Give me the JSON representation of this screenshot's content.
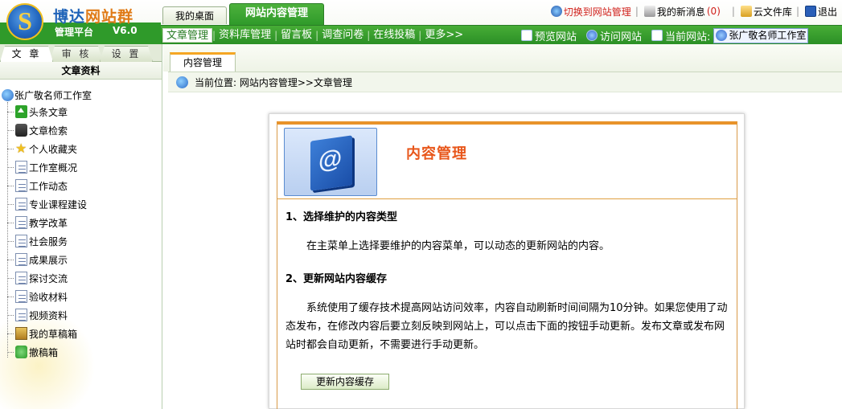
{
  "app": {
    "brand_part1": "博达",
    "brand_part2": "网站群",
    "platform_label": "管理平台",
    "version": "V6.0"
  },
  "top_tabs": [
    {
      "label": "我的桌面",
      "active": false
    },
    {
      "label": "网站内容管理",
      "active": true
    }
  ],
  "top_links": {
    "switch": "切换到网站管理",
    "messages": "我的新消息",
    "message_count": "(0)",
    "cloud": "云文件库",
    "logout": "退出"
  },
  "nav": {
    "items": [
      "文章管理",
      "资料库管理",
      "留言板",
      "调查问卷",
      "在线投稿",
      "更多>>"
    ],
    "active_index": 0,
    "preview": "预览网站",
    "visit": "访问网站",
    "current_label": "当前网站:",
    "current_site": "张广敬名师工作室"
  },
  "sidebar": {
    "tabs": [
      "文 章",
      "审 核",
      "设 置"
    ],
    "header": "文章资料",
    "root": "张广敬名师工作室",
    "items": [
      {
        "label": "头条文章",
        "icon": "up-arrow-icon"
      },
      {
        "label": "文章检索",
        "icon": "search-icon"
      },
      {
        "label": "个人收藏夹",
        "icon": "star-icon"
      },
      {
        "label": "工作室概况",
        "icon": "document-icon"
      },
      {
        "label": "工作动态",
        "icon": "document-icon"
      },
      {
        "label": "专业课程建设",
        "icon": "document-icon"
      },
      {
        "label": "教学改革",
        "icon": "document-icon"
      },
      {
        "label": "社会服务",
        "icon": "document-icon"
      },
      {
        "label": "成果展示",
        "icon": "document-icon"
      },
      {
        "label": "探讨交流",
        "icon": "document-icon"
      },
      {
        "label": "验收材料",
        "icon": "document-icon"
      },
      {
        "label": "视频资料",
        "icon": "document-icon"
      },
      {
        "label": "我的草稿箱",
        "icon": "draft-icon"
      },
      {
        "label": "撤稿箱",
        "icon": "recycle-icon"
      }
    ]
  },
  "main": {
    "tab": "内容管理",
    "breadcrumb": "当前位置: 网站内容管理>>文章管理",
    "panel_title": "内容管理",
    "section1_title": "1、选择维护的内容类型",
    "section1_text": "在主菜单上选择要维护的内容菜单，可以动态的更新网站的内容。",
    "section2_title": "2、更新网站内容缓存",
    "section2_text": "系统使用了缓存技术提高网站访问效率，内容自动刷新时间间隔为10分钟。如果您使用了动态发布，在修改内容后要立刻反映到网站上，可以点击下面的按钮手动更新。发布文章或发布网站时都会自动更新，不需要进行手动更新。",
    "refresh_button": "更新内容缓存"
  },
  "colors": {
    "nav_green": "#2f9a2a",
    "brand_blue": "#1f63b8",
    "brand_orange": "#e07b17",
    "panel_title": "#e8561a",
    "panel_border": "#e8932a",
    "alert_red": "#d0201a"
  }
}
